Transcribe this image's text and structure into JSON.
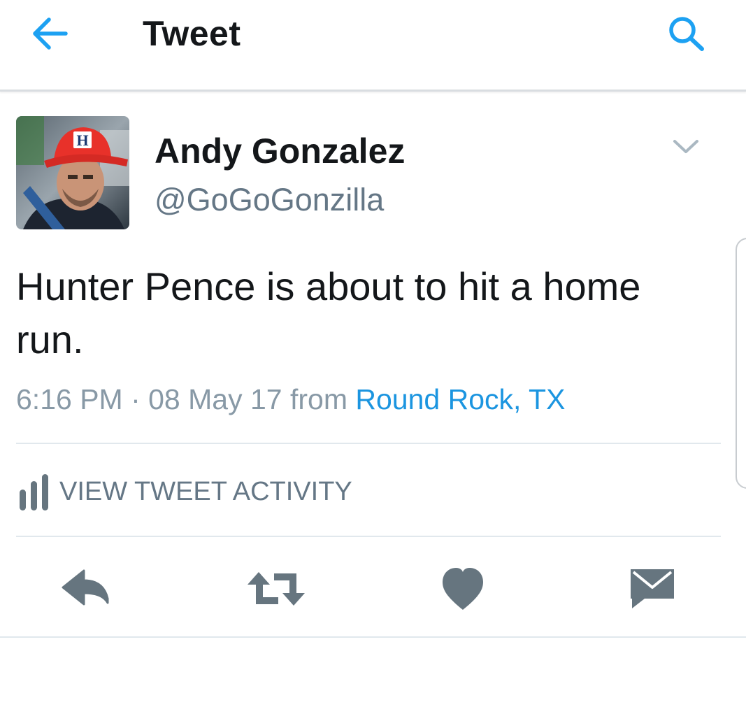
{
  "header": {
    "title": "Tweet",
    "back_icon": "arrow-left-icon",
    "search_icon": "search-icon",
    "accent_color": "#1da1f2"
  },
  "tweet": {
    "author_name": "Andy Gonzalez",
    "author_handle": "@GoGoGonzilla",
    "text": "Hunter Pence is about to hit a home run.",
    "time": "6:16 PM · 08 May 17",
    "from_label": "from",
    "location": "Round Rock, TX",
    "link_color": "#1b95e0"
  },
  "activity": {
    "label": "VIEW TWEET ACTIVITY",
    "icon": "bar-chart-icon"
  },
  "actions": {
    "reply_icon": "reply-icon",
    "retweet_icon": "retweet-icon",
    "like_icon": "heart-icon",
    "dm_icon": "envelope-icon",
    "icon_color": "#66757f"
  }
}
